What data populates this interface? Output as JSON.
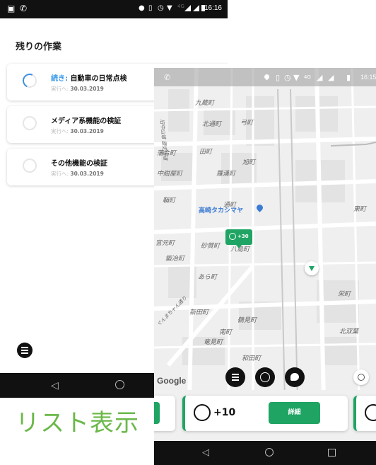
{
  "left_phone": {
    "status_bar": {
      "time": "16:16",
      "network": "4G"
    },
    "section_title": "残りの作業",
    "tasks": [
      {
        "prefix": "続き: ",
        "title": "自動車の日常点検",
        "sub_label": "実行へ: ",
        "date": "30.03.2019",
        "status": "in-progress"
      },
      {
        "prefix": "",
        "title": "メディア系機能の検証",
        "sub_label": "実行へ: ",
        "date": "30.03.2019",
        "status": "todo"
      },
      {
        "prefix": "",
        "title": "その他機能の検証",
        "sub_label": "実行へ: ",
        "date": "30.03.2019",
        "status": "todo"
      }
    ]
  },
  "caption": "リスト表示",
  "right_phone": {
    "status_bar": {
      "time": "16:15",
      "network": "4G"
    },
    "map_labels": {
      "kuzo": "九蔵町",
      "kitadori": "北通町",
      "yumi": "弓町",
      "ai": "藩合町",
      "ta": "田町",
      "asahi": "旭町",
      "nakakonya": "中紺屋町",
      "rashu": "羅漢町",
      "sen": "鞘町",
      "tori": "通町",
      "takashimaya": "高崎タカシマヤ",
      "higashi": "東町",
      "miyamoto": "宮元町",
      "sunaga": "砂賀町",
      "yashima": "八島町",
      "kaji": "鍛冶町",
      "ara": "あら町",
      "sakae": "栄町",
      "shinden": "新田町",
      "tsuruya": "鶴見町",
      "kitafuta": "北双葉",
      "minami": "南町",
      "tatsumi": "竜見町",
      "wada": "和田町",
      "street_vert": "旧中山道 歴史街道",
      "street_diag": "ぐんまちゃん通り"
    },
    "score_badge": "+30",
    "google_label": "Google",
    "task_tile": {
      "points": "+10",
      "detail_button": "詳細"
    }
  },
  "colors": {
    "accent_green": "#1fa464",
    "caption_green": "#6bb84a",
    "progress_blue": "#3d8fe0"
  }
}
